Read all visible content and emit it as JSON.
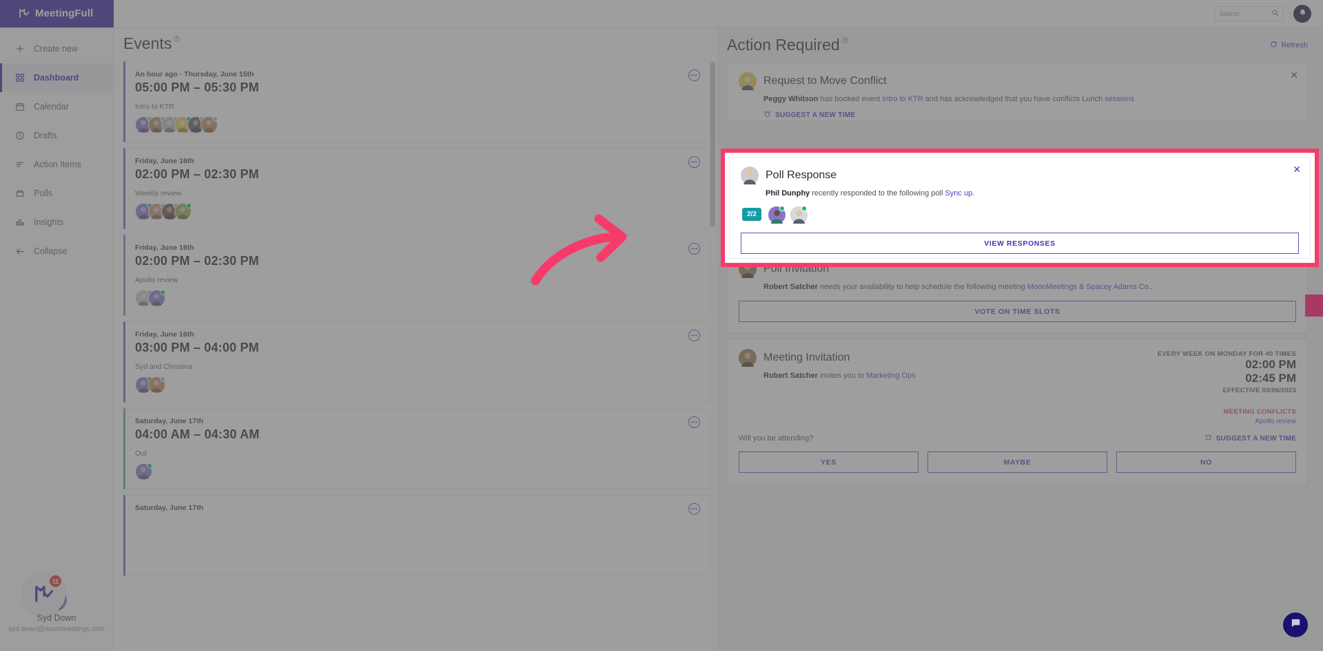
{
  "app": {
    "brand": "MeetingFull",
    "logo_icon": "meetingfull-logo-icon"
  },
  "topbar": {
    "search_placeholder": "Search",
    "search_value": "",
    "search_icon": "search-icon",
    "notifications_icon": "bell-icon"
  },
  "sidebar": {
    "items": [
      {
        "label": "Create new",
        "icon": "plus-icon"
      },
      {
        "label": "Dashboard",
        "icon": "grid-icon"
      },
      {
        "label": "Calendar",
        "icon": "calendar-icon"
      },
      {
        "label": "Drafts",
        "icon": "clock-icon"
      },
      {
        "label": "Action Items",
        "icon": "list-icon"
      },
      {
        "label": "Polls",
        "icon": "poll-icon"
      },
      {
        "label": "Insights",
        "icon": "bar-chart-icon"
      },
      {
        "label": "Collapse",
        "icon": "arrow-left-icon"
      }
    ],
    "active_index": 1,
    "user": {
      "name": "Syd Down",
      "email": "syd.down@moonmeetings.com",
      "avatar_icon": "user-avatar"
    },
    "launcher": {
      "badge_count": "11",
      "icon": "meetingfull-logo-icon"
    }
  },
  "events": {
    "title": "Events",
    "help_icon": "help-icon",
    "menu_icon": "more-dots-icon",
    "cards": [
      {
        "date": "An hour ago · Thursday, June 15th",
        "time": "05:00 PM – 05:30 PM",
        "name": "Intro to KTR",
        "accent": "#6a5fd6",
        "attendees": [
          {
            "color": "#8a74c9",
            "status": "away"
          },
          {
            "color": "#b08a62",
            "status": "away"
          },
          {
            "color": "#b9b9bd",
            "status": "away"
          },
          {
            "color": "#e8c54b",
            "status": "online"
          },
          {
            "color": "#5e5e68",
            "status": "away"
          },
          {
            "color": "#c08a5e",
            "status": "away"
          }
        ]
      },
      {
        "date": "Friday, June 16th",
        "time": "02:00 PM – 02:30 PM",
        "name": "Weekly review",
        "accent": "#6a5fd6",
        "attendees": [
          {
            "color": "#8a74c9",
            "status": "online"
          },
          {
            "color": "#c98f70",
            "status": "away"
          },
          {
            "color": "#6b5347",
            "status": "away"
          },
          {
            "color": "#93a84f",
            "status": "online"
          }
        ]
      },
      {
        "date": "Friday, June 16th",
        "time": "02:00 PM – 02:30 PM",
        "name": "Apollo review",
        "accent": "#7b86a8",
        "attendees": [
          {
            "color": "#c4c4c8",
            "status": "away"
          },
          {
            "color": "#8a74c9",
            "status": "online"
          }
        ]
      },
      {
        "date": "Friday, June 16th",
        "time": "03:00 PM – 04:00 PM",
        "name": "Syd and Christina",
        "accent": "#6a5fd6",
        "attendees": [
          {
            "color": "#8a74c9",
            "status": "online"
          },
          {
            "color": "#c08a5e",
            "status": "away"
          }
        ]
      },
      {
        "date": "Saturday, June 17th",
        "time": "04:00 AM – 04:30 AM",
        "name": "Out",
        "accent": "#5aa98a",
        "attendees": [
          {
            "color": "#8a74c9",
            "status": "online"
          }
        ]
      },
      {
        "date": "Saturday, June 17th",
        "time": "",
        "name": "",
        "accent": "#6a5fd6",
        "attendees": []
      }
    ]
  },
  "action_required": {
    "title": "Action Required",
    "help_icon": "help-icon",
    "refresh_label": "Refresh",
    "refresh_icon": "refresh-icon",
    "close_icon": "close-icon",
    "alarm_icon": "alarm-clock-icon",
    "cards": {
      "move_conflict": {
        "title": "Request to Move Conflict",
        "actor": "Peggy Whitson",
        "text_mid": " has booked event ",
        "link1": "Intro to KTR",
        "text_tail": " and has acknowledged that you have conflicts ",
        "link2": "Lunch sessions",
        "action_label": "SUGGEST A NEW TIME",
        "avatar_color": "#e8c54b"
      },
      "poll_response": {
        "title": "Poll Response",
        "actor": "Phil Dunphy",
        "text_mid": " recently responded to the following poll ",
        "link1": "Sync up",
        "text_tail": ".",
        "count_badge": "2/2",
        "button_label": "VIEW RESPONSES",
        "avatar_color": "#cbcbcf",
        "responders": [
          {
            "color": "#8a74c9",
            "status": "online"
          },
          {
            "color": "#d8d8dc",
            "status": "online"
          }
        ],
        "highlight_color": "#f83a6b"
      },
      "poll_invitation": {
        "title": "Poll Invitation",
        "actor": "Robert Satcher",
        "text_mid": " needs your availability to help schedule the following meeting ",
        "link1": "MoonMeetings & Spacey Adams Co.",
        "text_tail": ".",
        "button_label": "VOTE ON TIME SLOTS",
        "avatar_color": "#9c7a55"
      },
      "meeting_invitation": {
        "title": "Meeting Invitation",
        "actor": "Robert Satcher",
        "text_mid": " invites you to ",
        "link1": "Marketing Ops",
        "recurrence": "EVERY WEEK ON MONDAY FOR 40 TIMES",
        "start_time": "02:00 PM",
        "end_time": "02:45 PM",
        "effective": "EFFECTIVE 03/06/2023",
        "conflicts_label": "MEETING CONFLICTS",
        "conflict_item": "Apollo review",
        "suggest_label": "SUGGEST A NEW TIME",
        "attending_question": "Will you be attending?",
        "buttons": [
          "YES",
          "MAYBE",
          "NO"
        ],
        "avatar_color": "#9c7a55",
        "conflict_color": "#e03a5a"
      }
    }
  },
  "annotation": {
    "arrow_color": "#f83a6b",
    "arrow_icon": "curved-arrow-right-icon"
  },
  "chat_widget": {
    "icon": "chat-bubble-icon",
    "color": "#1a1170"
  }
}
